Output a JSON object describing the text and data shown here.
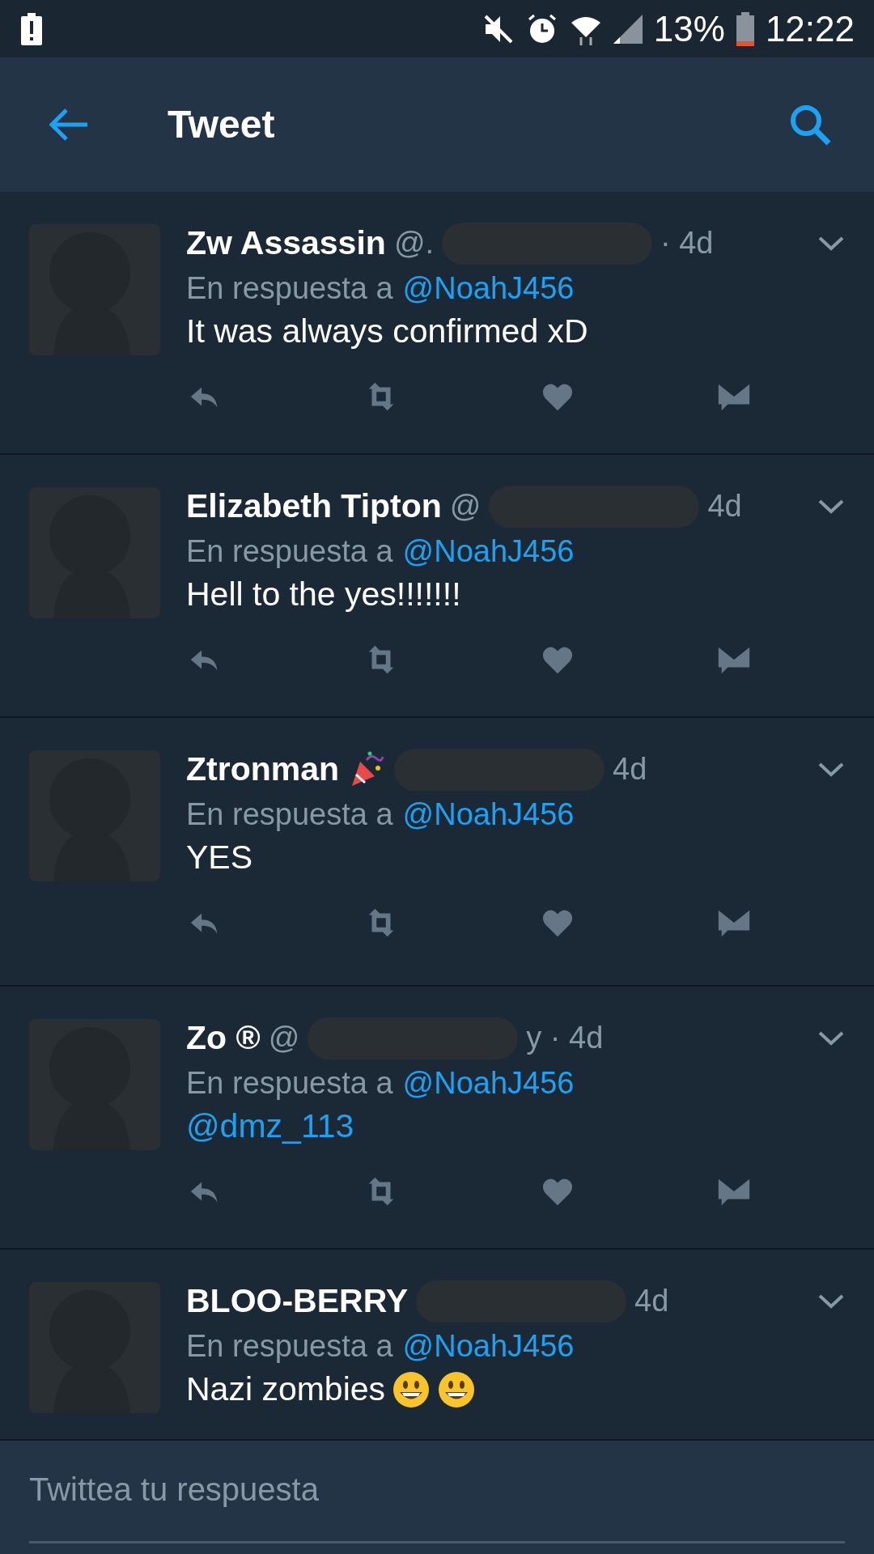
{
  "status_bar": {
    "battery": "13%",
    "time": "12:22"
  },
  "header": {
    "title": "Tweet"
  },
  "tweets": [
    {
      "name": "Zw Assassin",
      "handle": "@.",
      "after": "· 4d",
      "reply_label": "En respuesta a",
      "reply_to": "@NoahJ456",
      "body": "It was always confirmed xD",
      "kind": "text",
      "actions": true
    },
    {
      "name": "Elizabeth Tipton",
      "handle": "@",
      "after": "4d",
      "reply_label": "En respuesta a",
      "reply_to": "@NoahJ456",
      "body": "Hell to the yes!!!!!!!",
      "kind": "text",
      "actions": true
    },
    {
      "name": "Ztronman",
      "name_icon": {
        "kind": "party"
      },
      "after": "4d",
      "reply_label": "En respuesta a",
      "reply_to": "@NoahJ456",
      "body": "YES",
      "kind": "text",
      "actions": true
    },
    {
      "name": "Zo ®",
      "handle": "@",
      "after": "y · 4d",
      "reply_label": "En respuesta a",
      "reply_to": "@NoahJ456",
      "body": "@dmz_113",
      "kind": "mention",
      "actions": true
    },
    {
      "name": "BLOO-BERRY",
      "after": "4d",
      "reply_label": "En respuesta a",
      "reply_to": "@NoahJ456",
      "body": "Nazi zombies",
      "emoji": [
        {
          "kind": "grinning"
        },
        {
          "kind": "grinning"
        }
      ],
      "kind": "text",
      "actions": false
    }
  ],
  "reply_box": {
    "placeholder": "Twittea tu respuesta"
  }
}
